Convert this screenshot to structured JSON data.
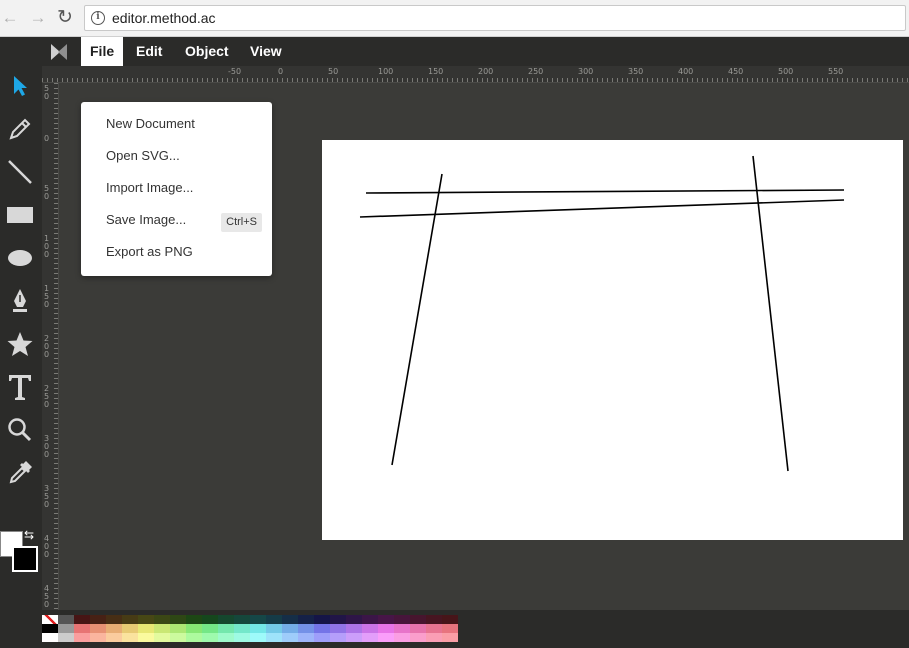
{
  "browser": {
    "url": "editor.method.ac",
    "back_icon": "←",
    "forward_icon": "→",
    "reload_icon": "↻",
    "info_icon": "i"
  },
  "menubar": {
    "items": [
      {
        "label": "File",
        "active": true
      },
      {
        "label": "Edit",
        "active": false
      },
      {
        "label": "Object",
        "active": false
      },
      {
        "label": "View",
        "active": false
      }
    ]
  },
  "file_menu": {
    "items": [
      {
        "label": "New Document",
        "shortcut": ""
      },
      {
        "label": "Open SVG...",
        "shortcut": ""
      },
      {
        "label": "Import Image...",
        "shortcut": ""
      },
      {
        "label": "Save Image...",
        "shortcut": "Ctrl+S"
      },
      {
        "label": "Export as PNG",
        "shortcut": ""
      }
    ]
  },
  "ruler": {
    "horizontal_labels": [
      "-50",
      "0",
      "50",
      "100",
      "150",
      "200",
      "250",
      "300",
      "350",
      "400",
      "450",
      "500",
      "550"
    ],
    "vertical_labels": [
      "50",
      "0",
      "50",
      "100",
      "150",
      "200",
      "250",
      "300",
      "350",
      "400",
      "450"
    ]
  },
  "tools": [
    "select-tool",
    "pencil-tool",
    "line-tool",
    "rectangle-tool",
    "ellipse-tool",
    "path-tool",
    "star-tool",
    "text-tool",
    "zoom-tool",
    "eyedropper-tool"
  ],
  "colors": {
    "fill": "#ffffff",
    "stroke": "#000000",
    "accent": "#1ea7e6"
  }
}
